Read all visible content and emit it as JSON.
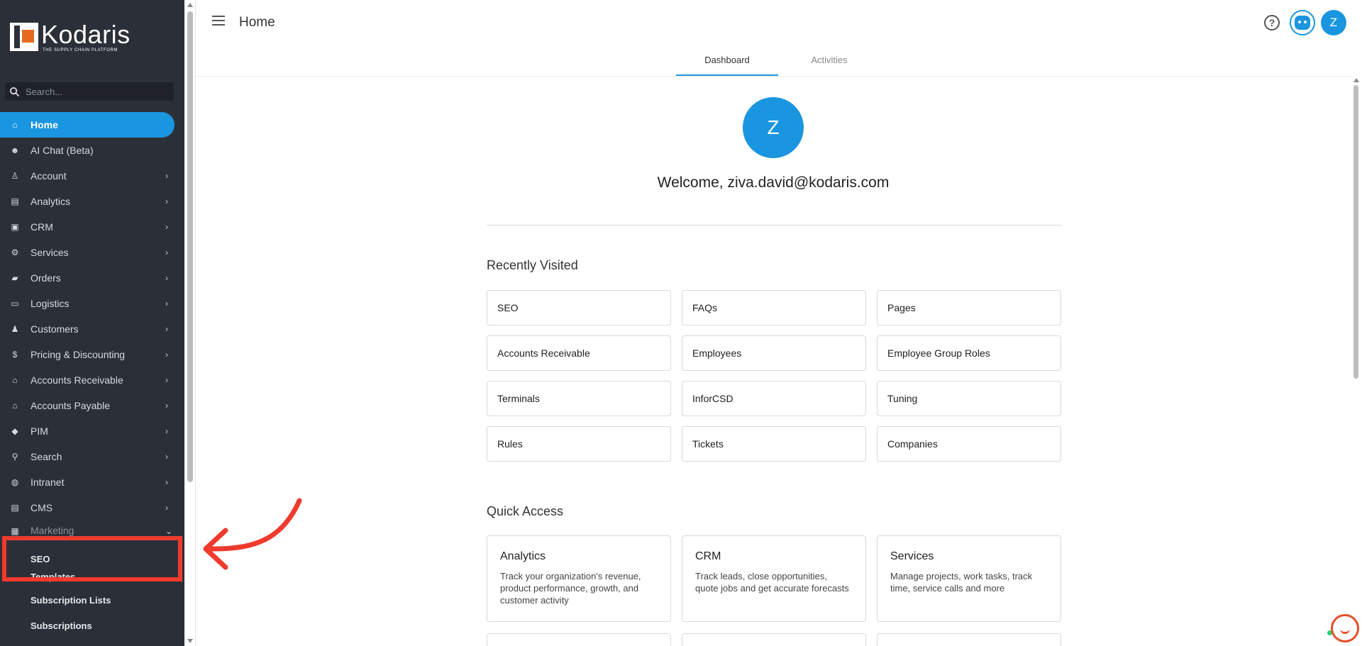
{
  "brand": {
    "name": "Kodaris",
    "tagline": "THE SUPPLY CHAIN PLATFORM"
  },
  "search": {
    "placeholder": "Search..."
  },
  "sidebar": {
    "items": [
      {
        "label": "Home",
        "icon": "home-icon",
        "active": true,
        "expandable": false
      },
      {
        "label": "AI Chat (Beta)",
        "icon": "robot-icon",
        "active": false,
        "expandable": false
      },
      {
        "label": "Account",
        "icon": "person-icon",
        "active": false,
        "expandable": true
      },
      {
        "label": "Analytics",
        "icon": "analytics-icon",
        "active": false,
        "expandable": true
      },
      {
        "label": "CRM",
        "icon": "contact-card-icon",
        "active": false,
        "expandable": true
      },
      {
        "label": "Services",
        "icon": "gears-icon",
        "active": false,
        "expandable": true
      },
      {
        "label": "Orders",
        "icon": "truck-icon",
        "active": false,
        "expandable": true
      },
      {
        "label": "Logistics",
        "icon": "delivery-icon",
        "active": false,
        "expandable": true
      },
      {
        "label": "Customers",
        "icon": "people-icon",
        "active": false,
        "expandable": true
      },
      {
        "label": "Pricing & Discounting",
        "icon": "dollar-icon",
        "active": false,
        "expandable": true
      },
      {
        "label": "Accounts Receivable",
        "icon": "bank-icon",
        "active": false,
        "expandable": true
      },
      {
        "label": "Accounts Payable",
        "icon": "bank-icon",
        "active": false,
        "expandable": true
      },
      {
        "label": "PIM",
        "icon": "tag-icon",
        "active": false,
        "expandable": true
      },
      {
        "label": "Search",
        "icon": "search-icon",
        "active": false,
        "expandable": true
      },
      {
        "label": "Intranet",
        "icon": "globe-icon",
        "active": false,
        "expandable": true
      },
      {
        "label": "CMS",
        "icon": "cms-icon",
        "active": false,
        "expandable": true
      },
      {
        "label": "Marketing",
        "icon": "marketing-icon",
        "active": false,
        "expandable": true
      }
    ],
    "marketing_sub": [
      {
        "label": "SEO"
      },
      {
        "label": "Templates"
      },
      {
        "label": "Subscription Lists"
      },
      {
        "label": "Subscriptions"
      }
    ]
  },
  "header": {
    "title": "Home",
    "help_label": "?",
    "user_initial": "Z"
  },
  "tabs": [
    {
      "label": "Dashboard",
      "active": true
    },
    {
      "label": "Activities",
      "active": false
    }
  ],
  "welcome": {
    "avatar_initial": "Z",
    "text": "Welcome, ziva.david@kodaris.com"
  },
  "recently_visited": {
    "title": "Recently Visited",
    "items": [
      "SEO",
      "FAQs",
      "Pages",
      "Accounts Receivable",
      "Employees",
      "Employee Group Roles",
      "Terminals",
      "InforCSD",
      "Tuning",
      "Rules",
      "Tickets",
      "Companies"
    ]
  },
  "quick_access": {
    "title": "Quick Access",
    "items": [
      {
        "title": "Analytics",
        "desc": "Track your organization's revenue, product performance, growth, and customer activity"
      },
      {
        "title": "CRM",
        "desc": "Track leads, close opportunities, quote jobs and get accurate forecasts"
      },
      {
        "title": "Services",
        "desc": "Manage projects, work tasks, track time, service calls and more"
      }
    ]
  },
  "colors": {
    "accent": "#1a95e0",
    "sidebar_bg": "#2b3038",
    "highlight": "#f03a2e",
    "brand_orange": "#e56a1f"
  }
}
